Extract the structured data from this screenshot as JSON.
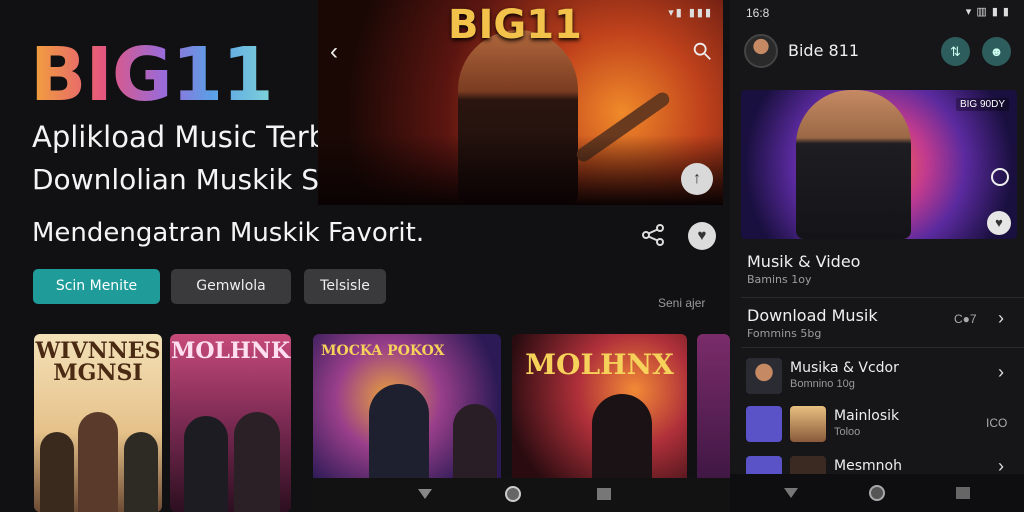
{
  "promo": {
    "brand": "BIG11",
    "tagline_1": "Aplikload Music Terbaik",
    "tagline_2": "Downlolian Muskik Siinderait",
    "tagline_3": "Mendengatran Muskik Favorit.",
    "pills": [
      "Scin Menite",
      "Gemwlola",
      "Telsisle"
    ],
    "see_all": "Seni ajer"
  },
  "hero": {
    "title": "BIG11",
    "status": "▾▮ ▮▮▮"
  },
  "cards": [
    {
      "title": "WIVNNES MGNSI"
    },
    {
      "title": "MOLHNK"
    },
    {
      "title": "MOCKA  POKOX"
    },
    {
      "title": "MOLHNX"
    }
  ],
  "phone": {
    "time": "16:8",
    "status_icons": "▾ ▥ ▮ ▮",
    "title": "Bide 811",
    "banner_badge": "BIG 90DY",
    "sections": [
      {
        "title": "Musik & Video",
        "subtitle": "Bamins 1oy"
      },
      {
        "title": "Download Musik",
        "subtitle": "Fommins 5bg",
        "meta": "C●7"
      }
    ],
    "list": [
      {
        "title": "Musika & Vcdor",
        "subtitle": "Bomnino 10g"
      },
      {
        "title": "Mainlosik",
        "subtitle": "Toloo",
        "meta": "ICO"
      },
      {
        "title": "Mesmnoh",
        "subtitle": ""
      }
    ]
  },
  "icons": {
    "back": "back-chevron",
    "search": "search",
    "share": "share",
    "heart": "heart",
    "nav": [
      "back-triangle",
      "home-circle",
      "recents-square"
    ]
  }
}
